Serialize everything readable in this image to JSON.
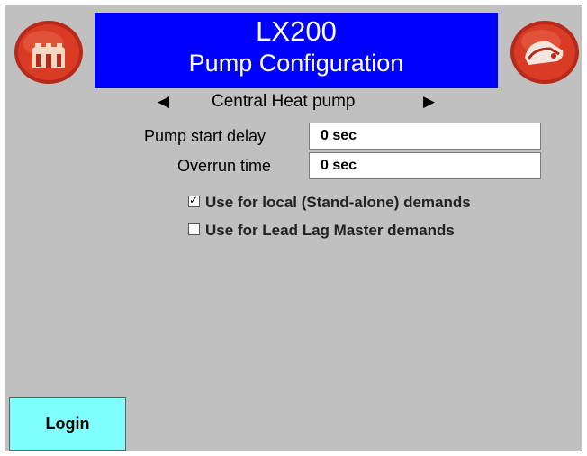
{
  "header": {
    "title": "LX200",
    "subtitle": "Pump Configuration",
    "accent_color": "#0000fe"
  },
  "nav": {
    "home_icon": "building-home-icon",
    "back_icon": "return-arrow-icon"
  },
  "selector": {
    "prev_arrow": "◀",
    "label": "Central Heat pump",
    "next_arrow": "▶"
  },
  "fields": [
    {
      "label": "Pump start delay",
      "value": "0 sec"
    },
    {
      "label": "Overrun time",
      "value": "0 sec"
    }
  ],
  "options": [
    {
      "label": "Use for local (Stand-alone) demands",
      "checked": true,
      "mark": "✓"
    },
    {
      "label": "Use for Lead Lag Master demands",
      "checked": false,
      "mark": ""
    }
  ],
  "login": {
    "label": "Login",
    "color": "#80ffff"
  }
}
